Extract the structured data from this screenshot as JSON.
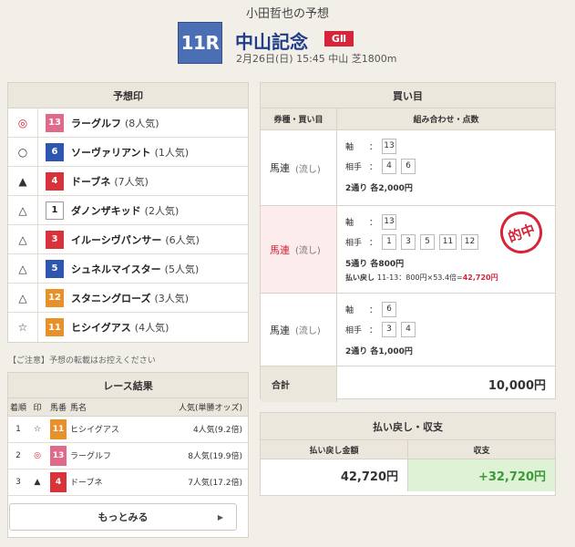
{
  "header": {
    "title": "小田哲也の予想",
    "race_number": "11R",
    "race_name": "中山記念",
    "grade": "GⅡ",
    "race_info": "2月26日(日) 15:45 中山 芝1800m"
  },
  "predictions": {
    "heading": "予想印",
    "rows": [
      {
        "mark": "◎",
        "num": "13",
        "name": "ラーグルフ",
        "pop": "(8人気)"
      },
      {
        "mark": "○",
        "num": "6",
        "name": "ソーヴァリアント",
        "pop": "(1人気)"
      },
      {
        "mark": "▲",
        "num": "4",
        "name": "ドーブネ",
        "pop": "(7人気)"
      },
      {
        "mark": "△",
        "num": "1",
        "name": "ダノンザキッド",
        "pop": "(2人気)"
      },
      {
        "mark": "△",
        "num": "3",
        "name": "イルーシヴパンサー",
        "pop": "(6人気)"
      },
      {
        "mark": "△",
        "num": "5",
        "name": "シュネルマイスター",
        "pop": "(5人気)"
      },
      {
        "mark": "△",
        "num": "12",
        "name": "スタニングローズ",
        "pop": "(3人気)"
      },
      {
        "mark": "☆",
        "num": "11",
        "name": "ヒシイグアス",
        "pop": "(4人気)"
      }
    ],
    "notice": "【ご注意】予想の転載はお控えください"
  },
  "results": {
    "heading": "レース結果",
    "columns": [
      "着順",
      "印",
      "馬番",
      "馬名",
      "人気(単勝オッズ)"
    ],
    "rows": [
      {
        "rank": "1",
        "mark": "☆",
        "num": "11",
        "name": "ヒシイグアス",
        "pop": "4人気(9.2倍)"
      },
      {
        "rank": "2",
        "mark": "◎",
        "num": "13",
        "name": "ラーグルフ",
        "pop": "8人気(19.9倍)"
      },
      {
        "rank": "3",
        "mark": "▲",
        "num": "4",
        "name": "ドーブネ",
        "pop": "7人気(17.2倍)"
      }
    ],
    "more_label": "もっとみる",
    "more_arrow": "▶"
  },
  "bets": {
    "heading": "買い目",
    "col_type": "券種・買い目",
    "col_combo": "組み合わせ・点数",
    "axis_label": "軸",
    "partner_label": "相手",
    "colon": "：",
    "rows": [
      {
        "type": "馬連",
        "sub": "(流し)",
        "axis": [
          "13"
        ],
        "partners": [
          "4",
          "6"
        ],
        "summary": "2通り 各2,000円",
        "hit": false
      },
      {
        "type": "馬連",
        "sub": "(流し)",
        "axis": [
          "13"
        ],
        "partners": [
          "1",
          "3",
          "5",
          "11",
          "12"
        ],
        "summary": "5通り 各800円",
        "hit": true,
        "payout_prefix": "払い戻し",
        "payout_detail": "11-13：800円×53.4倍=",
        "payout_amount": "42,720円",
        "stamp": "的中"
      },
      {
        "type": "馬連",
        "sub": "(流し)",
        "axis": [
          "6"
        ],
        "partners": [
          "3",
          "4"
        ],
        "summary": "2通り 各1,000円",
        "hit": false
      }
    ],
    "total_label": "合計",
    "total_value": "10,000円"
  },
  "payback": {
    "heading": "払い戻し・収支",
    "col_amount": "払い戻し金額",
    "col_balance": "収支",
    "amount": "42,720円",
    "balance": "+32,720円"
  }
}
